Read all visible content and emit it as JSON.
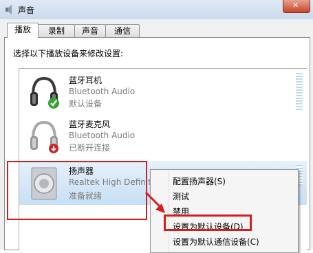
{
  "window": {
    "title": "声音"
  },
  "tabs": [
    {
      "label": "播放",
      "active": true
    },
    {
      "label": "录制",
      "active": false
    },
    {
      "label": "声音",
      "active": false
    },
    {
      "label": "通信",
      "active": false
    }
  ],
  "instruction": "选择以下播放设备来修改设置:",
  "devices": [
    {
      "name": "蓝牙耳机",
      "driver": "Bluetooth Audio",
      "status": "默认设备",
      "icon": "headphones-icon",
      "badge": "green-check"
    },
    {
      "name": "蓝牙麦克风",
      "driver": "Bluetooth Audio",
      "status": "已断开连接",
      "icon": "headphones-icon",
      "badge": "red-disconnect"
    },
    {
      "name": "扬声器",
      "driver": "Realtek High Definiti",
      "status": "准备就绪",
      "icon": "speaker-icon",
      "selected": true
    }
  ],
  "context_menu": {
    "items": [
      "配置扬声器(S)",
      "测试",
      "禁用",
      "设置为默认设备(D)",
      "设置为默认通信设备(C)"
    ],
    "highlighted": "设置为默认设备(D)"
  },
  "colors": {
    "annotation": "#d51d1d",
    "selection": "#c7dff5",
    "default_badge": "#2fa62f",
    "disconnect_badge": "#c62828"
  }
}
